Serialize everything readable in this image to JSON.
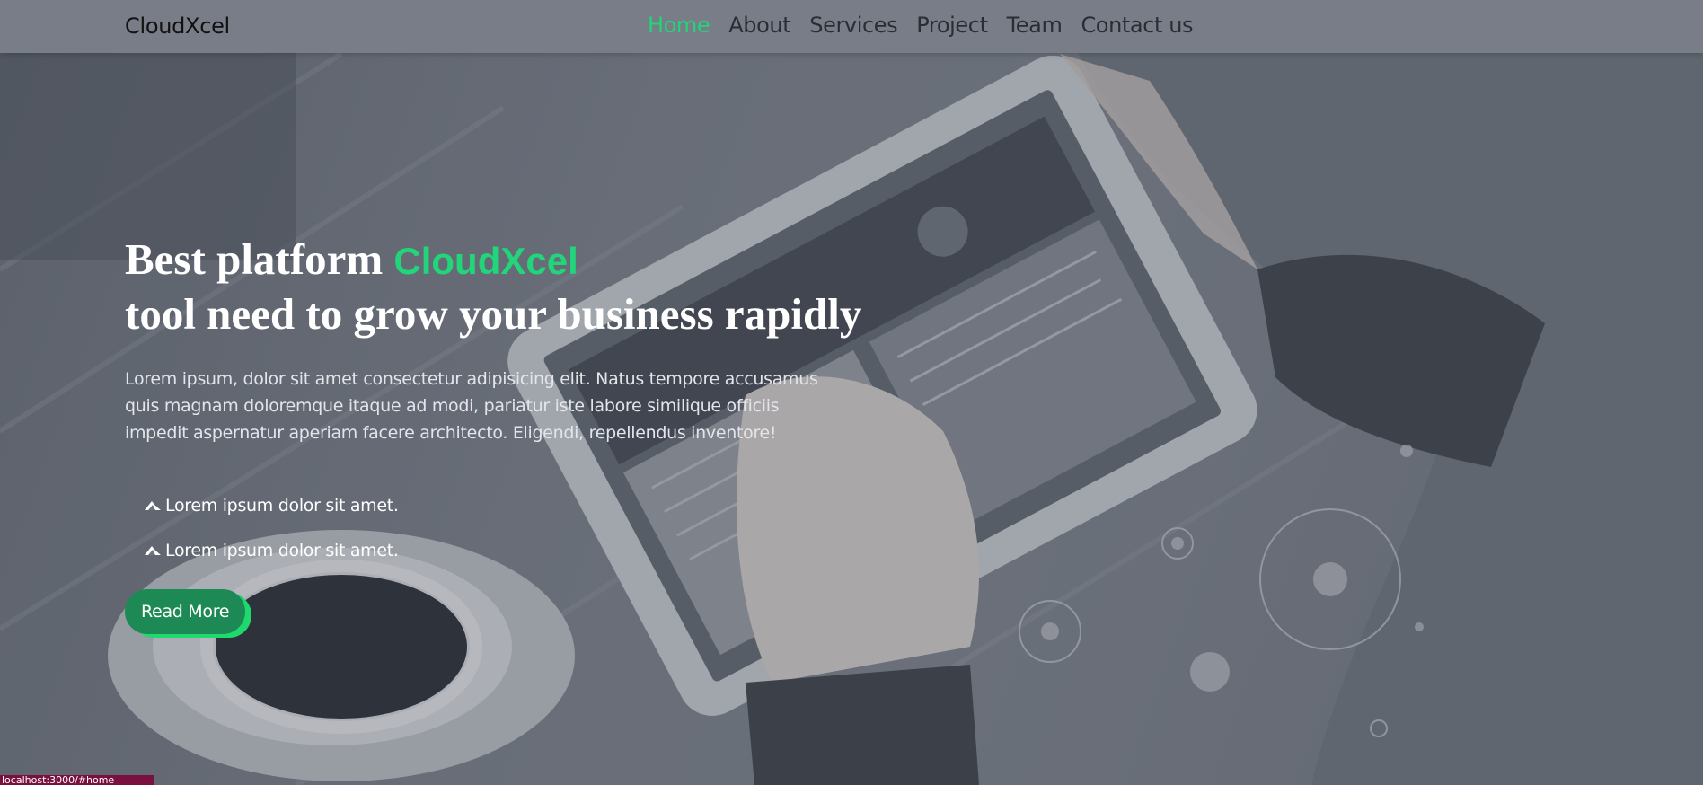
{
  "navbar": {
    "brand": "CloudXcel",
    "links": [
      {
        "label": "Home",
        "active": true
      },
      {
        "label": "About",
        "active": false
      },
      {
        "label": "Services",
        "active": false
      },
      {
        "label": "Project",
        "active": false
      },
      {
        "label": "Team",
        "active": false
      },
      {
        "label": "Contact us",
        "active": false
      }
    ]
  },
  "hero": {
    "headline_part1": "Best platform",
    "headline_accent": "CloudXcel",
    "headline_line2": "tool need to grow your business rapidly",
    "lead": "Lorem ipsum, dolor sit amet consectetur adipisicing elit. Natus tempore accusamus quis magnam doloremque itaque ad modi, pariatur iste labore similique officiis impedit aspernatur aperiam facere architecto. Eligendi, repellendus inventore!",
    "features": [
      {
        "icon": "arrow-icon",
        "text": "Lorem ipsum dolor sit amet."
      },
      {
        "icon": "arrow-icon",
        "text": "Lorem ipsum dolor sit amet."
      }
    ],
    "cta_label": "Read More"
  },
  "status_tip": "localhost:3000/#home",
  "colors": {
    "accent": "#22d47a",
    "button": "#1d8a55",
    "button_shadow": "#1fd86e",
    "navbar": "#787d87"
  }
}
